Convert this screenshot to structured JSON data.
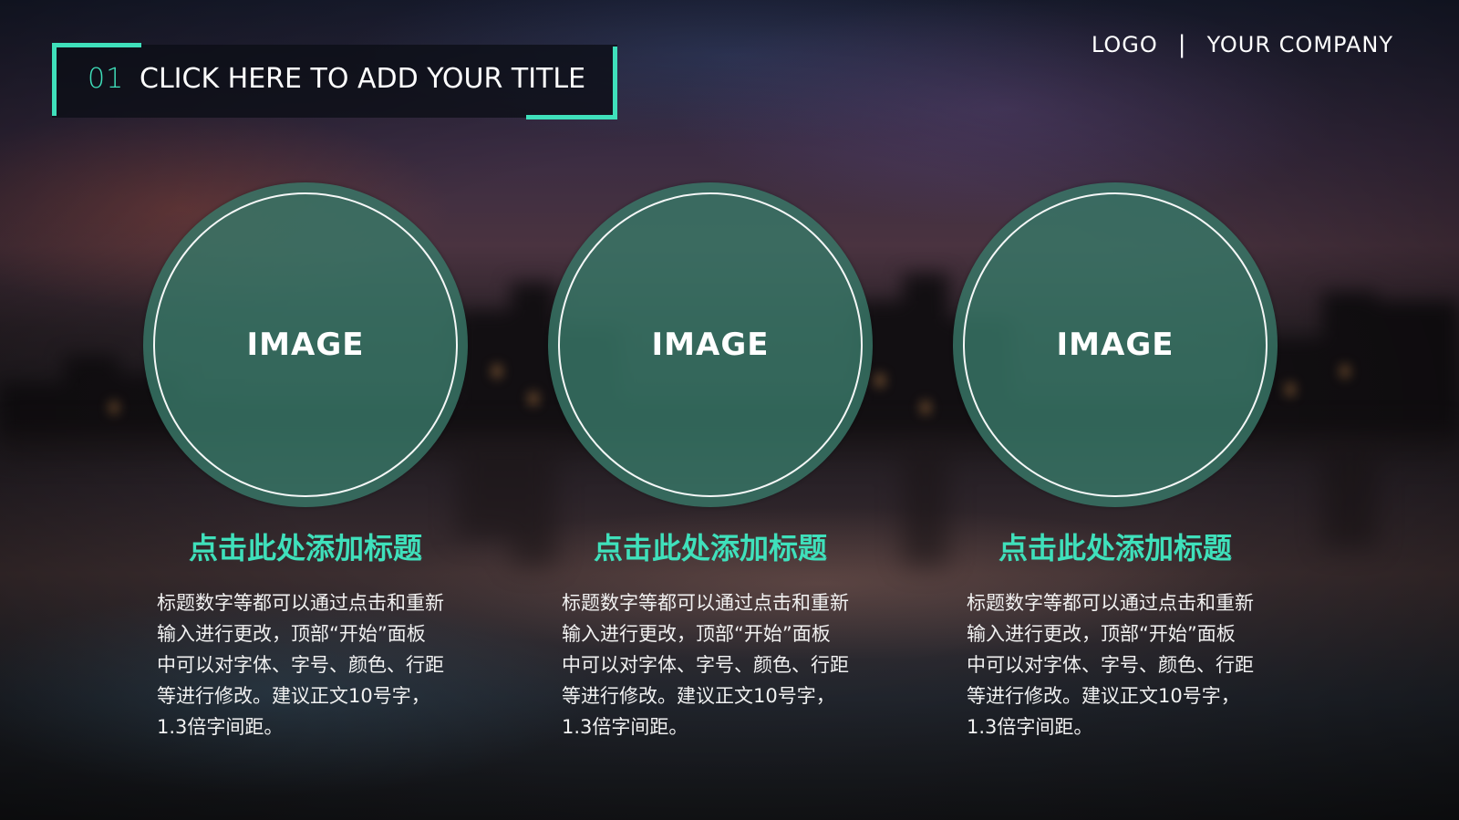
{
  "header": {
    "number": "01",
    "title": "CLICK HERE TO ADD YOUR TITLE",
    "logo": "LOGO",
    "separator": "|",
    "company": "YOUR COMPANY"
  },
  "colors": {
    "accent": "#3fe0bb",
    "circle_fill": "#387868",
    "text": "#ffffff"
  },
  "columns": [
    {
      "image_label": "IMAGE",
      "heading": "点击此处添加标题",
      "body_lines": [
        "标题数字等都可以通过点击和重新",
        "输入进行更改，顶部“开始”面板",
        "中可以对字体、字号、颜色、行距",
        "等进行修改。建议正文10号字，",
        "1.3倍字间距。"
      ]
    },
    {
      "image_label": "IMAGE",
      "heading": "点击此处添加标题",
      "body_lines": [
        "标题数字等都可以通过点击和重新",
        "输入进行更改，顶部“开始”面板",
        "中可以对字体、字号、颜色、行距",
        "等进行修改。建议正文10号字，",
        "1.3倍字间距。"
      ]
    },
    {
      "image_label": "IMAGE",
      "heading": "点击此处添加标题",
      "body_lines": [
        "标题数字等都可以通过点击和重新",
        "输入进行更改，顶部“开始”面板",
        "中可以对字体、字号、颜色、行距",
        "等进行修改。建议正文10号字，",
        "1.3倍字间距。"
      ]
    }
  ]
}
